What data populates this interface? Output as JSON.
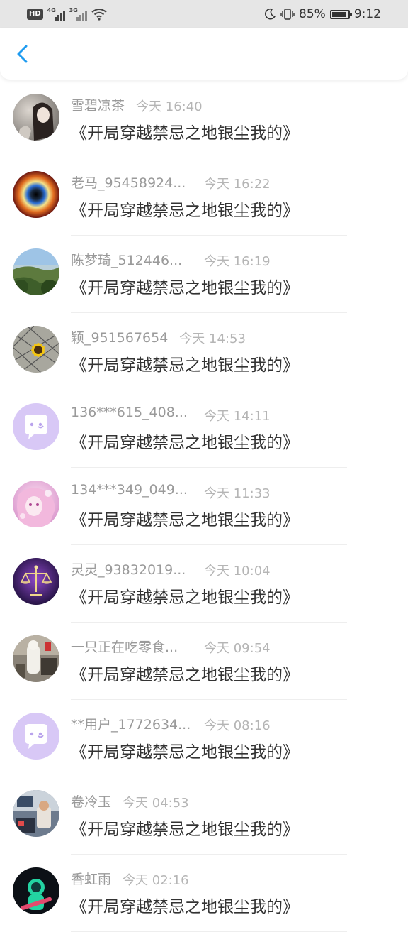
{
  "status_bar": {
    "left_badge": "HD",
    "net1": "4G",
    "net2": "3G",
    "battery_percent": "85%",
    "time": "9:12",
    "battery_level": 0.85
  },
  "nav": {
    "back_icon": "chevron-left-icon",
    "accent_color": "#1e9bf0"
  },
  "messages": [
    {
      "name": "雪碧凉茶",
      "time": "今天 16:40",
      "text": "《开局穿越禁忌之地银尘我的》",
      "avatar": "photo-woman"
    },
    {
      "name": "老马_95458924...",
      "time": "今天 16:22",
      "text": "《开局穿越禁忌之地银尘我的》",
      "avatar": "eye-iris"
    },
    {
      "name": "陈梦琦_512446...",
      "time": "今天 16:19",
      "text": "《开局穿越禁忌之地银尘我的》",
      "avatar": "landscape"
    },
    {
      "name": "颖_951567654",
      "time": "今天 14:53",
      "text": "《开局穿越禁忌之地银尘我的》",
      "avatar": "sunflower"
    },
    {
      "name": "136***615_408...",
      "time": "今天 14:11",
      "text": "《开局穿越禁忌之地银尘我的》",
      "avatar": "default-chat"
    },
    {
      "name": "134***349_049...",
      "time": "今天 11:33",
      "text": "《开局穿越禁忌之地银尘我的》",
      "avatar": "pink-anime"
    },
    {
      "name": "灵灵_93832019...",
      "time": "今天 10:04",
      "text": "《开局穿越禁忌之地银尘我的》",
      "avatar": "libra-purple"
    },
    {
      "name": "一只正在吃零食...",
      "time": "今天 09:54",
      "text": "《开局穿越禁忌之地银尘我的》",
      "avatar": "room-photo"
    },
    {
      "name": "**用户_1772634...",
      "time": "今天 08:16",
      "text": "《开局穿越禁忌之地银尘我的》",
      "avatar": "default-chat"
    },
    {
      "name": "卷冷玉",
      "time": "今天 04:53",
      "text": "《开局穿越禁忌之地银尘我的》",
      "avatar": "desk-photo"
    },
    {
      "name": "香虹雨",
      "time": "今天 02:16",
      "text": "《开局穿越禁忌之地银尘我的》",
      "avatar": "astronaut"
    }
  ]
}
